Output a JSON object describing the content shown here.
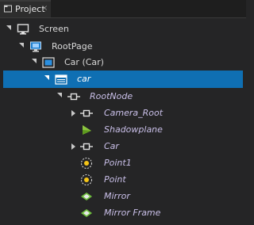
{
  "panel": {
    "tab_label": "Project",
    "tab_close": "×"
  },
  "tree": [
    {
      "label": "Screen",
      "icon": "monitor-icon",
      "expanded": true
    },
    {
      "label": "RootPage",
      "icon": "page-icon",
      "expanded": true
    },
    {
      "label": "Car (Car)",
      "icon": "viewport-icon",
      "expanded": true
    },
    {
      "label": "car",
      "icon": "scene-icon",
      "expanded": true,
      "selected": true
    },
    {
      "label": "RootNode",
      "icon": "node-icon",
      "expanded": true
    },
    {
      "label": "Camera_Root",
      "icon": "node-icon",
      "expanded": false
    },
    {
      "label": "Shadowplane",
      "icon": "mesh-icon",
      "expanded": null
    },
    {
      "label": "Car",
      "icon": "node-icon",
      "expanded": false
    },
    {
      "label": "Point1",
      "icon": "light-icon",
      "expanded": null
    },
    {
      "label": "Point",
      "icon": "light-icon",
      "expanded": null
    },
    {
      "label": "Mirror",
      "icon": "plane-icon",
      "expanded": null
    },
    {
      "label": "Mirror Frame",
      "icon": "plane-icon",
      "expanded": null
    }
  ],
  "colors": {
    "background": "#252526",
    "selection": "#0f6fb3",
    "italic_text": "#c9bfe8"
  }
}
